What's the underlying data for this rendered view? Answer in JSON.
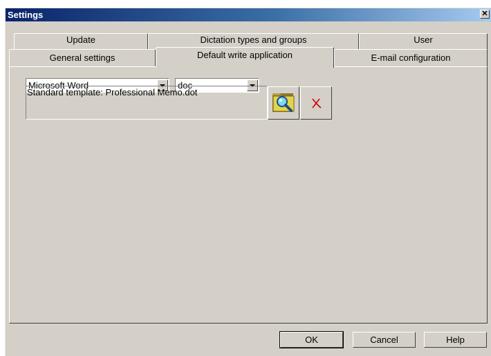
{
  "window": {
    "title": "Settings",
    "close_glyph": "✕"
  },
  "tabs_back": [
    {
      "label": "Update"
    },
    {
      "label": "Dictation types and groups"
    },
    {
      "label": "User"
    }
  ],
  "tabs_front": [
    {
      "label": "General settings"
    },
    {
      "label": "Default write application",
      "active": true
    },
    {
      "label": "E-mail configuration"
    }
  ],
  "panel": {
    "application_select": {
      "value": "Microsoft Word"
    },
    "extension_select": {
      "value": "doc"
    },
    "template_text": "Standard template: Professional Memo.dot",
    "browse_icon": "folder-search-icon",
    "remove_icon": "red-x-icon"
  },
  "buttons": {
    "ok": "OK",
    "cancel": "Cancel",
    "help": "Help"
  }
}
